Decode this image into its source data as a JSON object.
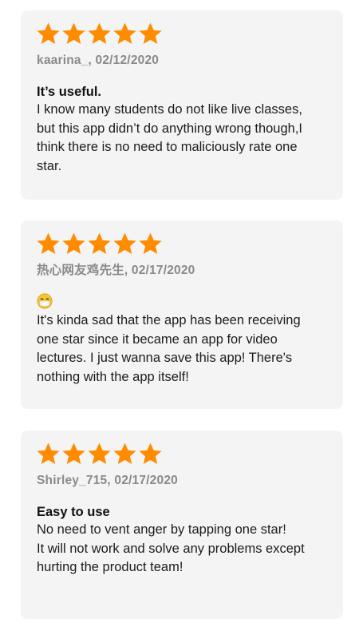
{
  "star_color": "#ff8c00",
  "reviews": [
    {
      "rating": 5,
      "author_date": "kaarina_, 02/12/2020",
      "title": "It’s useful.",
      "body": "I know many students do not like live classes,\nbut this app didn’t do anything wrong though,I\nthink there is no need to maliciously rate one\nstar."
    },
    {
      "rating": 5,
      "author_date": "热心网友鸡先生, 02/17/2020",
      "title_icon": "mask-face-emoji-icon",
      "body": "It's kinda sad that the app has been receiving\none star since it became an app for video\nlectures. I just wanna save this app! There's\nnothing with the app itself!"
    },
    {
      "rating": 5,
      "author_date": "Shirley_715, 02/17/2020",
      "title": "Easy to use",
      "body": "No need to vent anger by tapping one star!\nIt will not work and solve any problems except\nhurting the product team!"
    }
  ]
}
